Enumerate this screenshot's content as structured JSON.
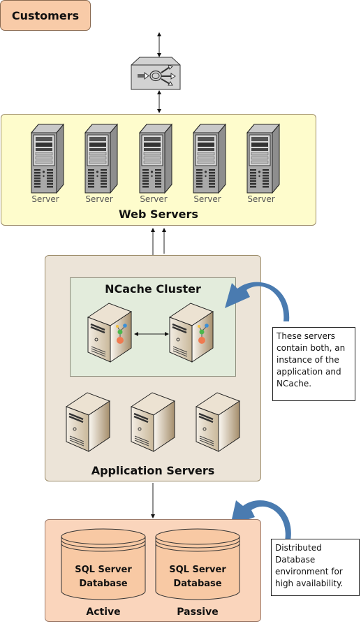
{
  "customers": {
    "label": "Customers"
  },
  "load_balancer": {
    "icon": "load-balancer-icon"
  },
  "web_servers": {
    "title": "Web Servers",
    "servers": [
      {
        "label": "Server"
      },
      {
        "label": "Server"
      },
      {
        "label": "Server"
      },
      {
        "label": "Server"
      },
      {
        "label": "Server"
      }
    ]
  },
  "ncache_cluster": {
    "title": "NCache Cluster",
    "node_count": 2
  },
  "application_servers": {
    "title": "Application Servers",
    "server_count": 3
  },
  "notes": {
    "app_note": "These servers contain both, an instance of the application and NCache.",
    "db_note": "Distributed Database environment for high availability."
  },
  "databases": {
    "items": [
      {
        "name": "SQL Server Database",
        "line1": "SQL Server",
        "line2": "Database",
        "role": "Active"
      },
      {
        "name": "SQL Server Database",
        "line1": "SQL Server",
        "line2": "Database",
        "role": "Passive"
      }
    ]
  },
  "colors": {
    "customers_fill": "#f8cba8",
    "web_fill": "#fefccc",
    "app_fill": "#ece4d8",
    "cluster_fill": "#e3ecdc",
    "db_fill": "#fad5bc",
    "callout_arrow": "#4a7bb0"
  }
}
